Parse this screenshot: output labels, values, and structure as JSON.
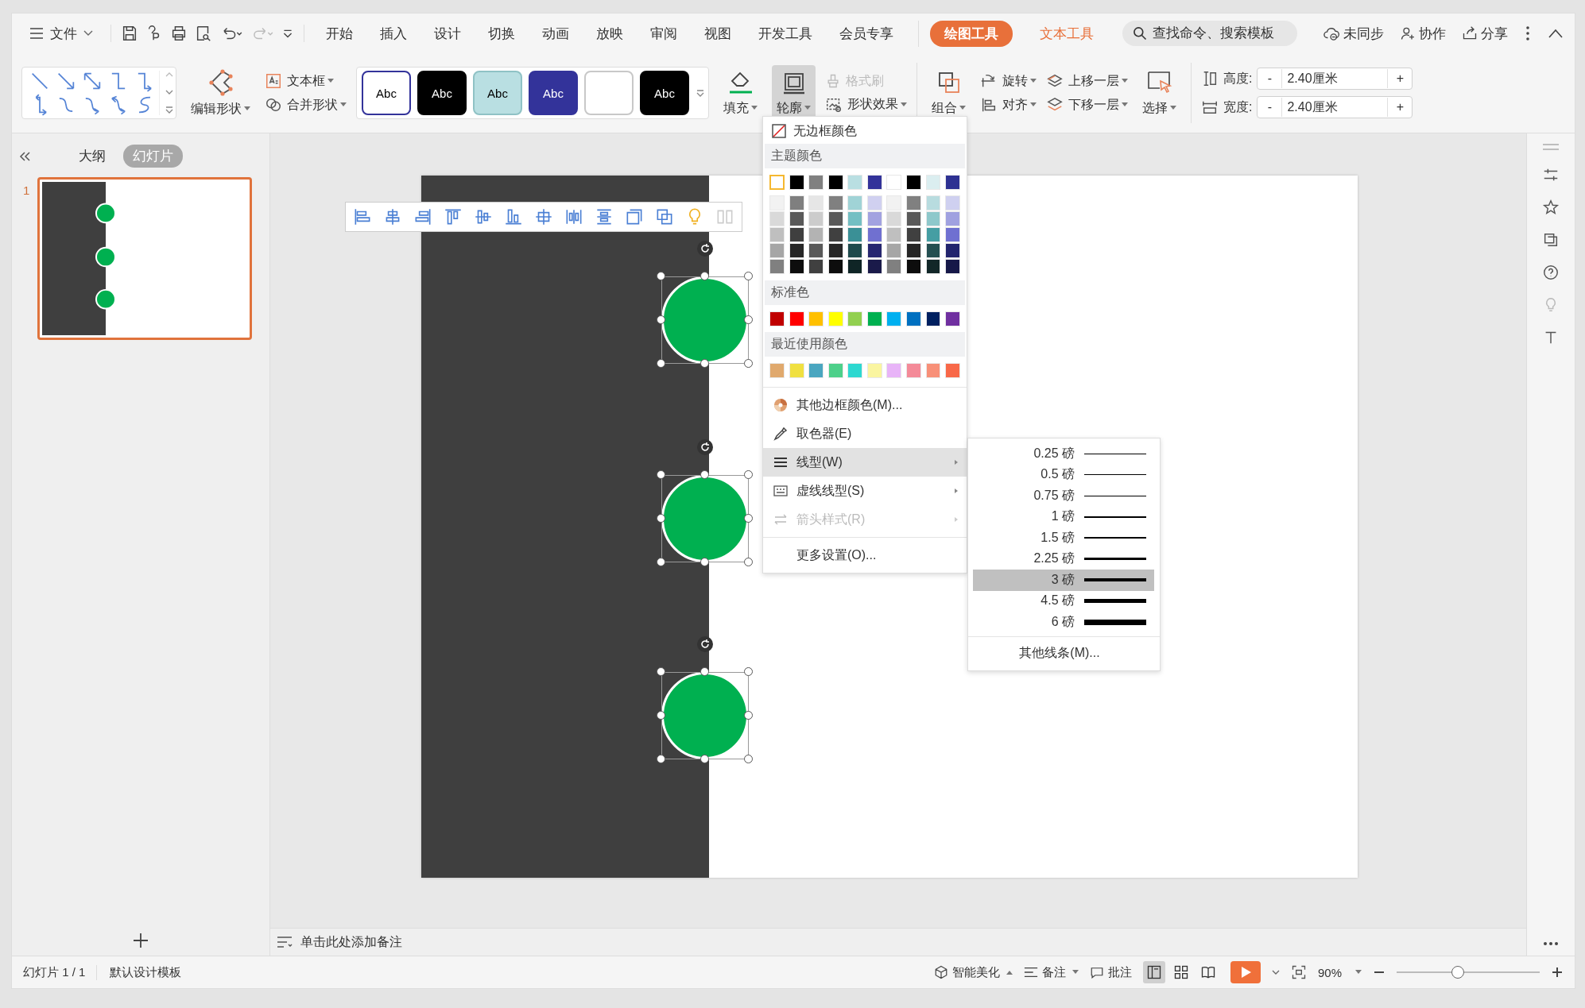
{
  "menu_bar": {
    "file": "文件",
    "tabs": [
      {
        "label": "开始",
        "selected": false
      },
      {
        "label": "插入",
        "selected": false
      },
      {
        "label": "设计",
        "selected": false
      },
      {
        "label": "切换",
        "selected": false
      },
      {
        "label": "动画",
        "selected": false
      },
      {
        "label": "放映",
        "selected": false
      },
      {
        "label": "审阅",
        "selected": false
      },
      {
        "label": "视图",
        "selected": false
      },
      {
        "label": "开发工具",
        "selected": false
      },
      {
        "label": "会员专享",
        "selected": false
      }
    ],
    "tool_tabs": [
      {
        "label": "绘图工具",
        "selected": true
      },
      {
        "label": "文本工具",
        "selected": false
      }
    ],
    "search": {
      "placeholder": "查找命令、搜索模板"
    },
    "actions": [
      {
        "kind": "sync",
        "label": "未同步"
      },
      {
        "kind": "collab",
        "label": "协作"
      },
      {
        "kind": "share",
        "label": "分享"
      }
    ]
  },
  "ribbon": {
    "edit_shape": "编辑形状",
    "text_box": "文本框",
    "merge_shape": "合并形状",
    "styles": [
      {
        "label": "Abc",
        "color": "#ffffff"
      },
      {
        "label": "Abc",
        "color": "#000000"
      },
      {
        "label": "Abc",
        "color": "#b9dfe2"
      },
      {
        "label": "Abc",
        "color": "#33339a"
      },
      {
        "color": "#ffffff"
      },
      {
        "label": "Abc",
        "color": "#000000"
      }
    ],
    "fill": "填充",
    "outline": {
      "label": "轮廓",
      "selected": true
    },
    "format_painter": {
      "label": "格式刷",
      "disabled": true
    },
    "shape_effect": "形状效果",
    "group": "组合",
    "rotate": "旋转",
    "align": "对齐",
    "bring_forward": "上移一层",
    "send_backward": "下移一层",
    "select": "选择",
    "height": {
      "label": "高度:",
      "decrement": "-",
      "value": "2.40厘米",
      "increment": "+"
    },
    "width": {
      "label": "宽度:",
      "decrement": "-",
      "value": "2.40厘米",
      "increment": "+"
    }
  },
  "left_panel": {
    "tabs": [
      {
        "label": "大纲",
        "selected": false
      },
      {
        "label": "幻灯片",
        "selected": true
      }
    ],
    "thumbnails": [
      {
        "number": "1",
        "selected": true
      }
    ]
  },
  "slide": {
    "shapes": [
      {
        "kind": "circle",
        "selected": true
      },
      {
        "kind": "circle",
        "selected": true
      },
      {
        "kind": "circle",
        "selected": true
      }
    ]
  },
  "outline_menu": {
    "no_border": "无边框颜色",
    "theme_title": "主题颜色",
    "theme_colors": [
      {
        "color": "#ffffff",
        "selected": true
      },
      {
        "color": "#000000",
        "selected": false
      },
      {
        "color": "#808080",
        "selected": false
      },
      {
        "color": "#000000",
        "selected": false
      },
      {
        "color": "#b9dfe2",
        "selected": false
      },
      {
        "color": "#33339a",
        "selected": false
      },
      {
        "color": "#ffffff",
        "selected": false
      },
      {
        "color": "#000000",
        "selected": false
      },
      {
        "color": "#dbeef0",
        "selected": false
      },
      {
        "color": "#2e3192",
        "selected": false
      }
    ],
    "theme_shades": [
      [
        {
          "color": "#f2f2f2"
        },
        {
          "color": "#7f7f7f"
        },
        {
          "color": "#e6e6e6"
        },
        {
          "color": "#808080"
        },
        {
          "color": "#a0d3d6"
        },
        {
          "color": "#d0d0f0"
        },
        {
          "color": "#f2f2f2"
        },
        {
          "color": "#808080"
        },
        {
          "color": "#b8dcdf"
        },
        {
          "color": "#cfd0f0"
        }
      ],
      [
        {
          "color": "#d9d9d9"
        },
        {
          "color": "#595959"
        },
        {
          "color": "#cccccc"
        },
        {
          "color": "#595959"
        },
        {
          "color": "#74bfc3"
        },
        {
          "color": "#a2a2e0"
        },
        {
          "color": "#d9d9d9"
        },
        {
          "color": "#595959"
        },
        {
          "color": "#8ec8cb"
        },
        {
          "color": "#a0a1e0"
        }
      ],
      [
        {
          "color": "#bfbfbf"
        },
        {
          "color": "#3f3f3f"
        },
        {
          "color": "#b3b3b3"
        },
        {
          "color": "#404040"
        },
        {
          "color": "#3a9096"
        },
        {
          "color": "#7070d0"
        },
        {
          "color": "#bfbfbf"
        },
        {
          "color": "#404040"
        },
        {
          "color": "#459ea3"
        },
        {
          "color": "#6f70d1"
        }
      ],
      [
        {
          "color": "#a6a6a6"
        },
        {
          "color": "#262626"
        },
        {
          "color": "#595959"
        },
        {
          "color": "#262626"
        },
        {
          "color": "#1f4a4c"
        },
        {
          "color": "#262670"
        },
        {
          "color": "#a6a6a6"
        },
        {
          "color": "#262626"
        },
        {
          "color": "#244f51"
        },
        {
          "color": "#22246d"
        }
      ],
      [
        {
          "color": "#808080"
        },
        {
          "color": "#0d0d0d"
        },
        {
          "color": "#404040"
        },
        {
          "color": "#0d0d0d"
        },
        {
          "color": "#0f2526"
        },
        {
          "color": "#1a1a4a"
        },
        {
          "color": "#808080"
        },
        {
          "color": "#0d0d0d"
        },
        {
          "color": "#122728"
        },
        {
          "color": "#161848"
        }
      ]
    ],
    "standard_title": "标准色",
    "standard_colors": [
      {
        "color": "#c00000"
      },
      {
        "color": "#ff0000"
      },
      {
        "color": "#ffc000"
      },
      {
        "color": "#ffff00"
      },
      {
        "color": "#92d050"
      },
      {
        "color": "#00b050"
      },
      {
        "color": "#00b0f0"
      },
      {
        "color": "#0070c0"
      },
      {
        "color": "#002060"
      },
      {
        "color": "#7030a0"
      }
    ],
    "recent_title": "最近使用颜色",
    "recent_colors": [
      {
        "color": "#e0a96d"
      },
      {
        "color": "#f0e040"
      },
      {
        "color": "#4aa6c0"
      },
      {
        "color": "#4dd08a"
      },
      {
        "color": "#2dd8d0"
      },
      {
        "color": "#faf5a0"
      },
      {
        "color": "#e8b4f8"
      },
      {
        "color": "#f48a98"
      },
      {
        "color": "#f89078"
      },
      {
        "color": "#f86848"
      }
    ],
    "items": [
      {
        "kind": "palette",
        "label": "其他边框颜色(M)...",
        "selected": false,
        "disabled": false,
        "submenu": false
      },
      {
        "kind": "eyedropper",
        "label": "取色器(E)",
        "selected": false,
        "disabled": false,
        "submenu": false
      },
      {
        "kind": "lines",
        "label": "线型(W)",
        "selected": true,
        "disabled": false,
        "submenu": true
      },
      {
        "kind": "dashes",
        "label": "虚线线型(S)",
        "selected": false,
        "disabled": false,
        "submenu": true
      },
      {
        "kind": "arrows",
        "label": "箭头样式(R)",
        "selected": false,
        "disabled": true,
        "submenu": true
      },
      {
        "kind": "plain",
        "label": "更多设置(O)...",
        "selected": false,
        "disabled": false,
        "submenu": false
      }
    ]
  },
  "line_weight_menu": {
    "weights": [
      {
        "label": "0.25 磅",
        "selected": false
      },
      {
        "label": "0.5 磅",
        "selected": false
      },
      {
        "label": "0.75 磅",
        "selected": false
      },
      {
        "label": "1 磅",
        "selected": false
      },
      {
        "label": "1.5 磅",
        "selected": false
      },
      {
        "label": "2.25 磅",
        "selected": false
      },
      {
        "label": "3 磅",
        "selected": true
      },
      {
        "label": "4.5 磅",
        "selected": false
      },
      {
        "label": "6 磅",
        "selected": false
      }
    ],
    "more": "其他线条(M)..."
  },
  "notes": {
    "placeholder": "单击此处添加备注"
  },
  "status_bar": {
    "slide": "幻灯片 1 / 1",
    "template": "默认设计模板",
    "beautify": "智能美化",
    "notes": "备注",
    "comments": "批注",
    "views": [
      {
        "kind": "normal",
        "selected": true
      },
      {
        "kind": "sorter",
        "selected": false
      },
      {
        "kind": "reading",
        "selected": false
      }
    ],
    "zoom": "90%",
    "zoom_slider": {
      "level": 0.43
    }
  }
}
